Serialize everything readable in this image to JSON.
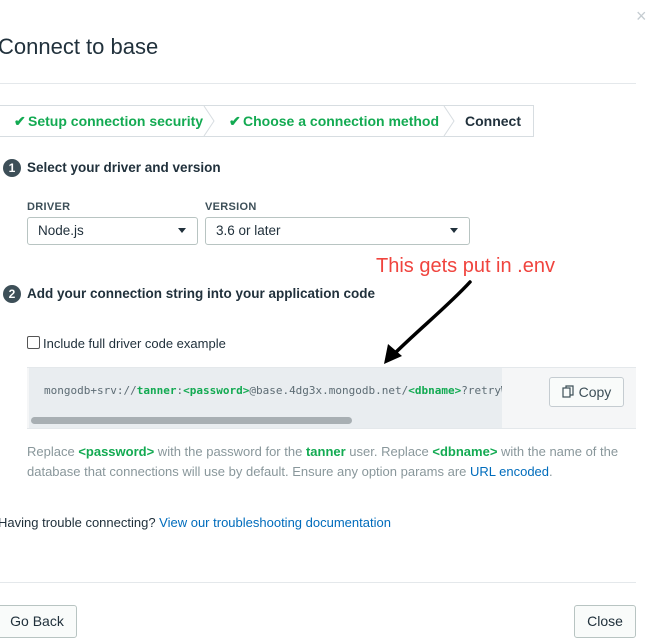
{
  "modal": {
    "title": "Connect to base",
    "close_glyph": "×"
  },
  "steps": [
    {
      "label": "Setup connection security",
      "done": true
    },
    {
      "label": "Choose a connection method",
      "done": true
    },
    {
      "label": "Connect",
      "done": false
    }
  ],
  "check_glyph": "✔",
  "section1": {
    "number": "1",
    "heading": "Select your driver and version"
  },
  "driver": {
    "label": "DRIVER",
    "value": "Node.js"
  },
  "version": {
    "label": "VERSION",
    "value": "3.6 or later"
  },
  "annotation": {
    "text": "This gets put in .env"
  },
  "section2": {
    "number": "2",
    "heading": "Add your connection string into your application code"
  },
  "include_example": {
    "label": "Include full driver code example",
    "checked": false
  },
  "connection_string": {
    "prefix": "mongodb+srv://",
    "user": "tanner",
    "sep1": ":",
    "password_placeholder": "<password>",
    "host": "@base.4dg3x.mongodb.net/",
    "dbname_placeholder": "<dbname>",
    "suffix": "?retryWrites=true&w=majority"
  },
  "copy_button": {
    "label": "Copy",
    "icon": "copy-icon"
  },
  "note": {
    "t1": "Replace ",
    "password": "<password>",
    "t2": " with the password for the ",
    "user": "tanner",
    "t3": " user. Replace ",
    "dbname": "<dbname>",
    "t4": " with the name of the database that connections will use by default. Ensure any option params are ",
    "link": "URL encoded",
    "t5": "."
  },
  "trouble": {
    "text": "Having trouble connecting? ",
    "link": "View our troubleshooting documentation"
  },
  "footer": {
    "back": "Go Back",
    "close": "Close"
  },
  "colors": {
    "accent_green": "#13aa52",
    "link_blue": "#006cbc",
    "annotation_red": "#f0443e"
  }
}
